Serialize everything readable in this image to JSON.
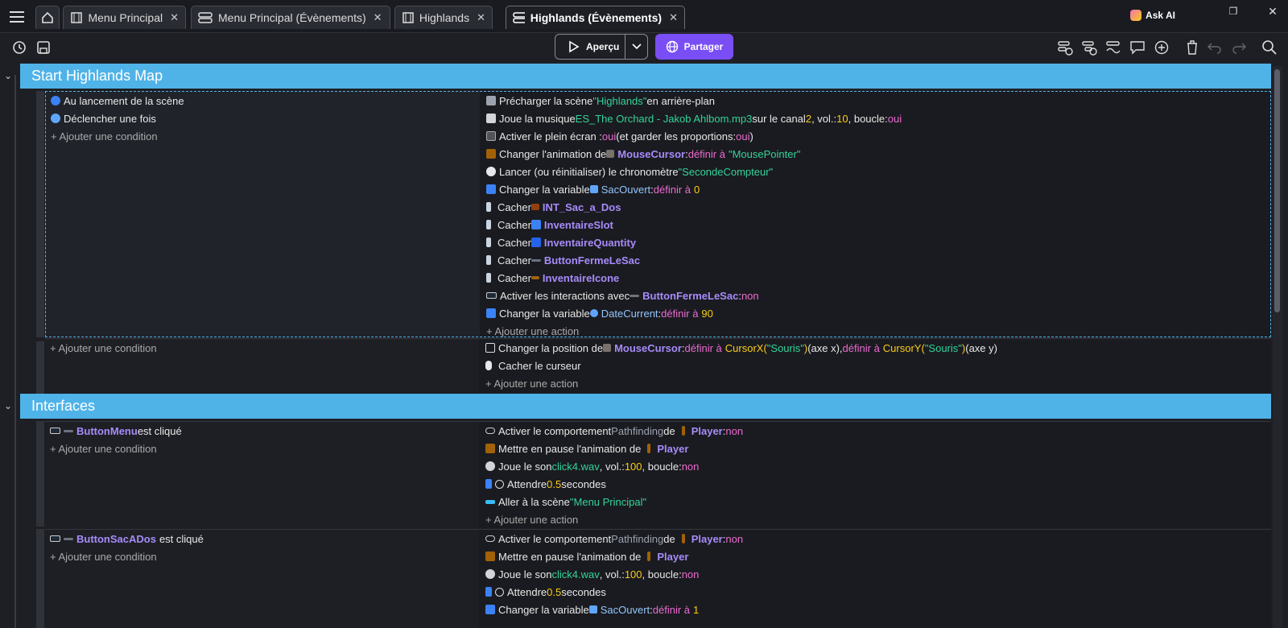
{
  "tabs": [
    {
      "label": "Menu Principal",
      "icon": "scene-icon"
    },
    {
      "label": "Menu Principal (Évènements)",
      "icon": "events-icon"
    },
    {
      "label": "Highlands",
      "icon": "scene-icon"
    },
    {
      "label": "Highlands (Évènements)",
      "icon": "events-icon",
      "active": true
    }
  ],
  "ask_ai": "Ask AI",
  "toolbar": {
    "apercu": "Aperçu",
    "partager": "Partager"
  },
  "colors": {
    "accent": "#7a4ef5",
    "group": "#4fb3e8",
    "object": "#a78bfa",
    "string": "#34d399",
    "number": "#facc15",
    "keyword": "#ec6bd0"
  },
  "groups": [
    {
      "title": "Start Highlands Map"
    },
    {
      "title": "Interfaces"
    }
  ],
  "add_condition": "+ Ajouter une condition",
  "add_action": "+ Ajouter une action",
  "ev1": {
    "conds": [
      "Au lancement de la scène",
      "Déclencher une fois"
    ],
    "a1": [
      "Précharger la scène ",
      "\"Highlands\"",
      " en arrière-plan"
    ],
    "a2": [
      "Joue la musique ",
      "ES_The Orchard - Jakob Ahlbom.mp3",
      " sur le canal ",
      "2",
      ", vol.: ",
      "10",
      ", boucle: ",
      "oui"
    ],
    "a3": [
      "Activer le plein écran : ",
      "oui",
      " (et garder les proportions: ",
      "oui",
      ")"
    ],
    "a4": [
      "Changer l'animation de ",
      "MouseCursor",
      ": ",
      "définir à ",
      "\"MousePointer\""
    ],
    "a5": [
      "Lancer (ou réinitialiser) le chronomètre ",
      "\"SecondeCompteur\""
    ],
    "a6": [
      "Changer la variable ",
      "SacOuvert",
      ": ",
      "définir à ",
      "0"
    ],
    "a7": [
      "Cacher ",
      "INT_Sac_a_Dos"
    ],
    "a8": [
      "Cacher ",
      "InventaireSlot"
    ],
    "a9": [
      "Cacher ",
      "InventaireQuantity"
    ],
    "a10": [
      "Cacher ",
      "ButtonFermeLeSac"
    ],
    "a11": [
      "Cacher ",
      "InventaireIcone"
    ],
    "a12": [
      "Activer les interactions avec ",
      "ButtonFermeLeSac",
      ": ",
      "non"
    ],
    "a13": [
      "Changer la variable ",
      "DateCurrent",
      ": ",
      "définir à ",
      "90"
    ]
  },
  "ev2": {
    "a1": [
      "Changer la position de ",
      "MouseCursor",
      ": ",
      "définir à ",
      "CursorX(",
      "\"Souris\"",
      ")",
      " (axe x), ",
      "définir à ",
      "CursorY(",
      "\"Souris\"",
      ")",
      " (axe y)"
    ],
    "a2": [
      "Cacher le curseur"
    ]
  },
  "ev3": {
    "cond": [
      "ButtonMenu",
      " est cliqué"
    ],
    "a1": [
      "Activer le comportement ",
      "Pathfinding",
      " de ",
      "Player",
      " : ",
      "non"
    ],
    "a2": [
      "Mettre en pause l'animation de ",
      "Player"
    ],
    "a3": [
      "Joue le son ",
      "click4.wav",
      ", vol.: ",
      "100",
      ", boucle: ",
      "non"
    ],
    "a4": [
      "Attendre ",
      "0.5",
      " secondes"
    ],
    "a5": [
      "Aller à la scène ",
      "\"Menu Principal\""
    ]
  },
  "ev4": {
    "cond": [
      "ButtonSacADos",
      " est cliqué"
    ],
    "a1": [
      "Activer le comportement ",
      "Pathfinding",
      " de ",
      "Player",
      " : ",
      "non"
    ],
    "a2": [
      "Mettre en pause l'animation de ",
      "Player"
    ],
    "a3": [
      "Joue le son ",
      "click4.wav",
      ", vol.: ",
      "100",
      ", boucle: ",
      "non"
    ],
    "a4": [
      "Attendre ",
      "0.5",
      " secondes"
    ],
    "a5": [
      "Changer la variable ",
      "SacOuvert",
      ": ",
      "définir à ",
      "1"
    ]
  }
}
